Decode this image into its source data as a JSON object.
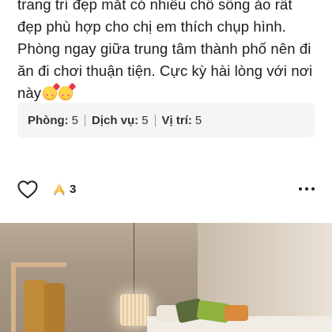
{
  "review": {
    "lines": [
      "trang trí đẹp mắt có nhiều chỗ sống ảo rất",
      "đẹp phù hợp cho chị em thích chụp hình.",
      "Phòng ngay giữa trung tâm thành phố nên đi",
      "ăn đi chơi thuận tiện.  Cực kỳ hài lòng với nơi",
      "này"
    ]
  },
  "ratings": [
    {
      "label": "Phòng:",
      "value": "5"
    },
    {
      "label": "Dịch vụ:",
      "value": "5"
    },
    {
      "label": "Vị trí:",
      "value": "5"
    }
  ],
  "actions": {
    "like_icon": "heart-outline-icon",
    "reaction_icon": "folded-hands-icon",
    "reaction_count": "3",
    "more_icon": "ellipsis-icon"
  }
}
